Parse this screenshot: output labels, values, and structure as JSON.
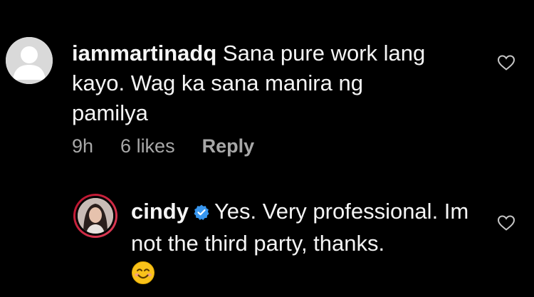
{
  "comments": [
    {
      "username": "iammartinadq",
      "text": "Sana pure work lang kayo. Wag ka sana manira ng pamilya",
      "time": "9h",
      "likes": "6 likes",
      "reply_label": "Reply",
      "avatar": "default-avatar-icon",
      "like_icon": "heart-outline-icon"
    },
    {
      "username": "cindy",
      "verified": true,
      "text": "Yes. Very professional. Im not the third party, thanks.",
      "emoji": "smiling-face-emoji",
      "avatar": "profile-photo",
      "like_icon": "heart-outline-icon"
    }
  ],
  "colors": {
    "background": "#000000",
    "text": "#f5f5f5",
    "meta": "#a8a8a8",
    "verified_badge": "#3897f0",
    "story_ring": "#c2183a"
  }
}
